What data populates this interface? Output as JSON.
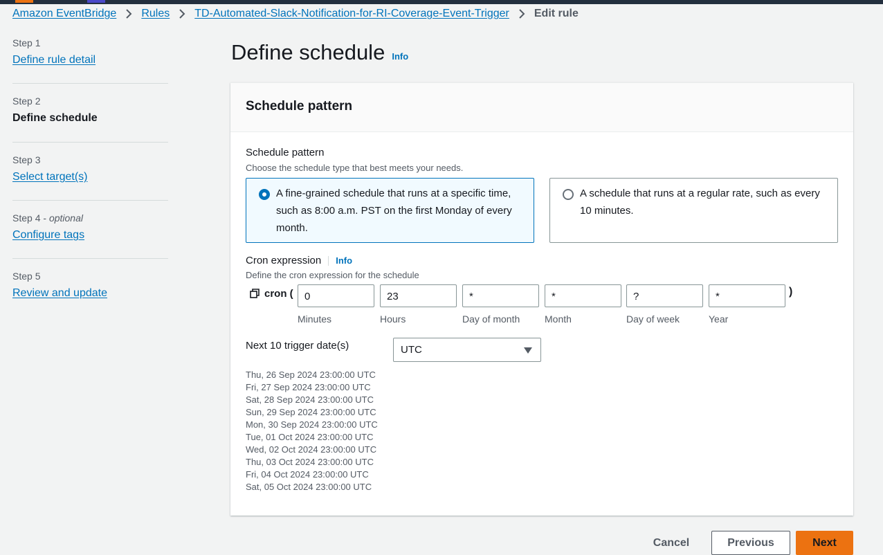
{
  "breadcrumb": {
    "items": [
      "Amazon EventBridge",
      "Rules",
      "TD-Automated-Slack-Notification-for-RI-Coverage-Event-Trigger"
    ],
    "current": "Edit rule"
  },
  "steps": [
    {
      "number": "Step 1",
      "optional": "",
      "title": "Define rule detail"
    },
    {
      "number": "Step 2",
      "optional": "",
      "title": "Define schedule"
    },
    {
      "number": "Step 3",
      "optional": "",
      "title": "Select target(s)"
    },
    {
      "number": "Step 4",
      "optional": "optional",
      "title": "Configure tags"
    },
    {
      "number": "Step 5",
      "optional": "",
      "title": "Review and update"
    }
  ],
  "page": {
    "title": "Define schedule",
    "info": "Info"
  },
  "container": {
    "header": "Schedule pattern",
    "pattern_label": "Schedule pattern",
    "pattern_desc": "Choose the schedule type that best meets your needs.",
    "options": [
      {
        "text": "A fine-grained schedule that runs at a specific time, such as 8:00 a.m. PST on the first Monday of every month.",
        "selected": true
      },
      {
        "text": "A schedule that runs at a regular rate, such as every 10 minutes.",
        "selected": false
      }
    ],
    "cron_label": "Cron expression",
    "cron_info": "Info",
    "cron_desc": "Define the cron expression for the schedule",
    "cron_prefix": "cron (",
    "cron_suffix": ")",
    "cron_fields": [
      {
        "value": "0",
        "caption": "Minutes"
      },
      {
        "value": "23",
        "caption": "Hours"
      },
      {
        "value": "*",
        "caption": "Day of month"
      },
      {
        "value": "*",
        "caption": "Month"
      },
      {
        "value": "?",
        "caption": "Day of week"
      },
      {
        "value": "*",
        "caption": "Year"
      }
    ],
    "next_label": "Next 10 trigger date(s)",
    "timezone": "UTC",
    "dates": [
      "Thu, 26 Sep 2024 23:00:00 UTC",
      "Fri, 27 Sep 2024 23:00:00 UTC",
      "Sat, 28 Sep 2024 23:00:00 UTC",
      "Sun, 29 Sep 2024 23:00:00 UTC",
      "Mon, 30 Sep 2024 23:00:00 UTC",
      "Tue, 01 Oct 2024 23:00:00 UTC",
      "Wed, 02 Oct 2024 23:00:00 UTC",
      "Thu, 03 Oct 2024 23:00:00 UTC",
      "Fri, 04 Oct 2024 23:00:00 UTC",
      "Sat, 05 Oct 2024 23:00:00 UTC"
    ]
  },
  "footer": {
    "cancel": "Cancel",
    "previous": "Previous",
    "next": "Next"
  },
  "colors": {
    "link": "#0073bb",
    "primary_button": "#ec7211",
    "selected_tile_bg": "#f1faff"
  }
}
